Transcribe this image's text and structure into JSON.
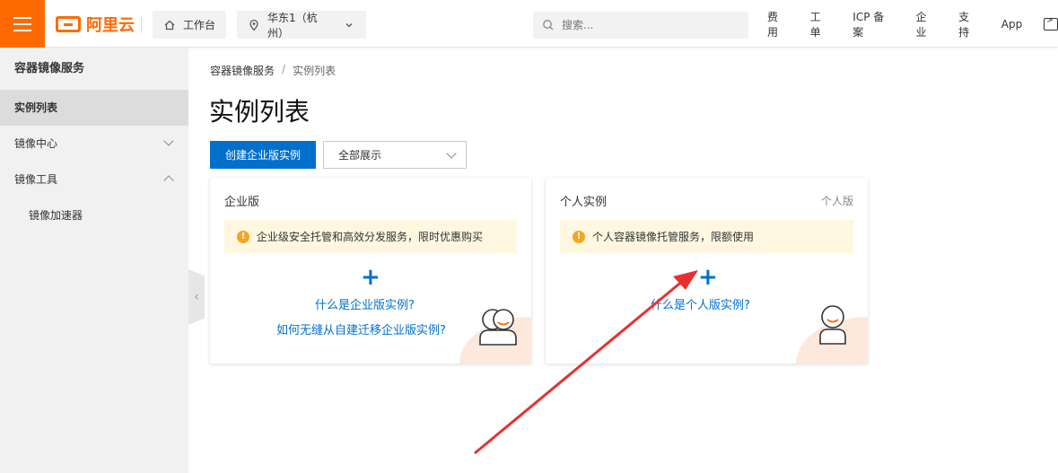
{
  "topbar": {
    "logo_text": "阿里云",
    "workbench_label": "工作台",
    "region_label": "华东1（杭州）",
    "search_placeholder": "搜索...",
    "links": [
      "费用",
      "工单",
      "ICP 备案",
      "企业",
      "支持",
      "App"
    ],
    "accent_color": "#ff6a00"
  },
  "sidebar": {
    "title": "容器镜像服务",
    "items": [
      {
        "label": "实例列表",
        "active": true
      },
      {
        "label": "镜像中心",
        "expand": "chevron-down"
      },
      {
        "label": "镜像工具",
        "expand": "chevron-up"
      },
      {
        "label": "镜像加速器",
        "sub": true
      }
    ]
  },
  "breadcrumb": {
    "root": "容器镜像服务",
    "sep": "/",
    "current": "实例列表"
  },
  "page": {
    "title": "实例列表",
    "create_button": "创建企业版实例",
    "filter_value": "全部展示",
    "primary_color": "#0070cc"
  },
  "cards": {
    "enterprise": {
      "title": "企业版",
      "notice": "企业级安全托管和高效分发服务，限时优惠购买",
      "link1": "什么是企业版实例?",
      "link2": "如何无缝从自建迁移企业版实例?"
    },
    "personal": {
      "title": "个人实例",
      "tag": "个人版",
      "notice": "个人容器镜像托管服务，限额使用",
      "link1": "什么是个人版实例?"
    }
  },
  "plus_glyph": "+",
  "collapse_glyph": "‹",
  "warn_glyph": "!"
}
